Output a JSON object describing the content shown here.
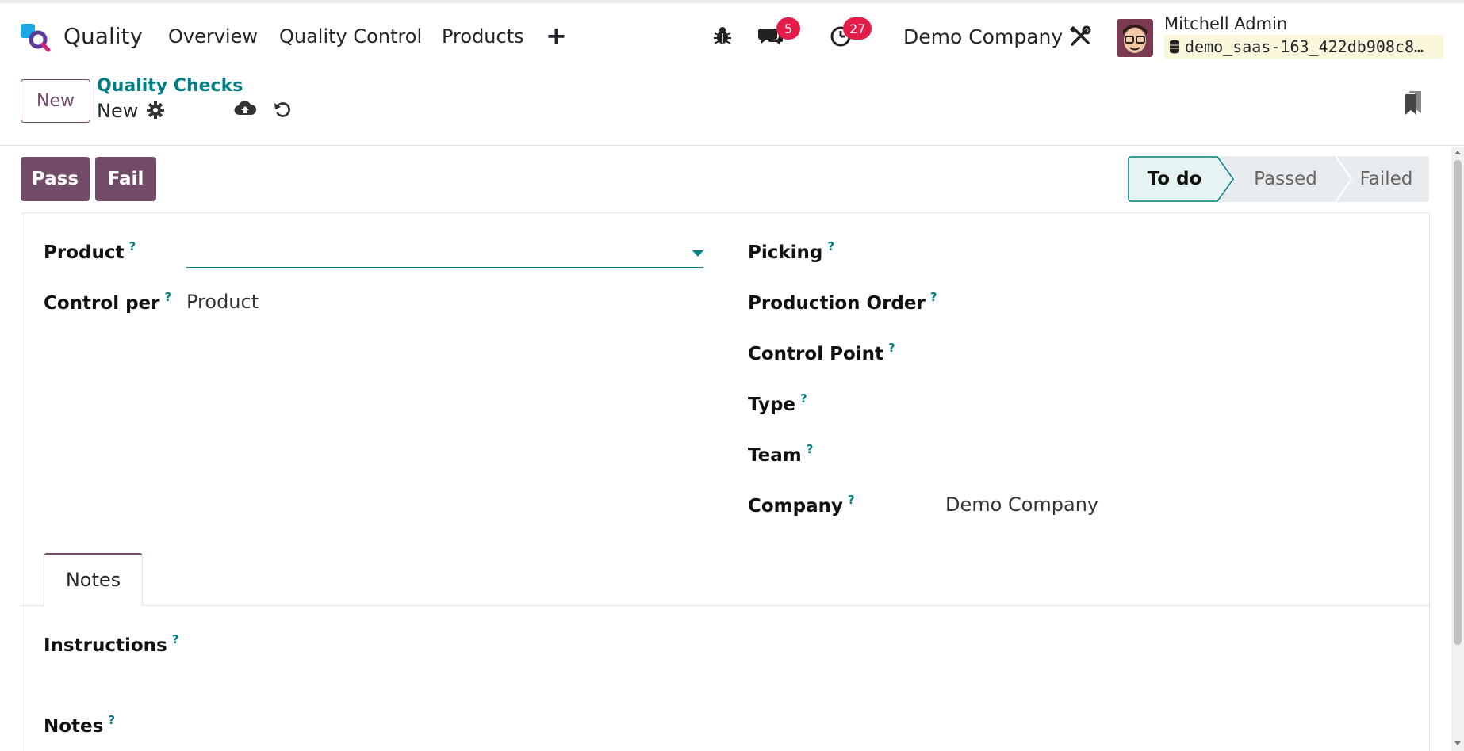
{
  "nav": {
    "app_name": "Quality",
    "menus": [
      "Overview",
      "Quality Control",
      "Products"
    ],
    "plus": "+",
    "messages_count": "5",
    "activities_count": "27",
    "company": "Demo Company",
    "user_name": "Mitchell Admin",
    "db_name": "demo_saas-163_422db908c8…"
  },
  "control_panel": {
    "new_label": "New",
    "breadcrumb_parent": "Quality Checks",
    "breadcrumb_current": "New"
  },
  "statusbar": {
    "pass_label": "Pass",
    "fail_label": "Fail",
    "stages": [
      "To do",
      "Passed",
      "Failed"
    ],
    "active_stage": "To do"
  },
  "form": {
    "left": {
      "product_label": "Product",
      "product_value": "",
      "control_per_label": "Control per",
      "control_per_value": "Product"
    },
    "right": {
      "picking_label": "Picking",
      "production_order_label": "Production Order",
      "control_point_label": "Control Point",
      "type_label": "Type",
      "team_label": "Team",
      "company_label": "Company",
      "company_value": "Demo Company"
    },
    "help_marker": "?"
  },
  "tabs": {
    "notes_tab": "Notes",
    "instructions_label": "Instructions",
    "notes_label": "Notes"
  },
  "colors": {
    "brand": "#714b67",
    "link": "#017e84",
    "badge": "#e41c4a",
    "active_stage_bg": "#e6f3f3"
  }
}
